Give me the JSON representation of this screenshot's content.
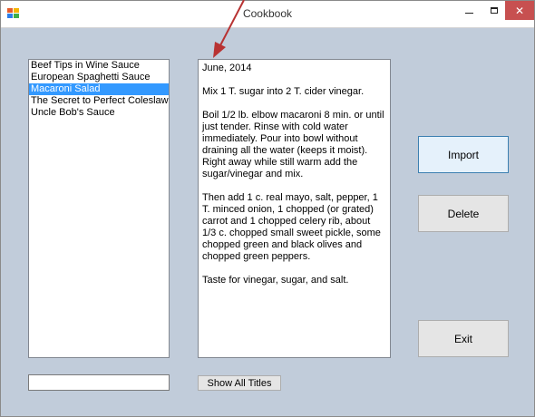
{
  "window": {
    "title": "Cookbook",
    "close_glyph": "✕"
  },
  "recipes": [
    {
      "title": "Beef Tips in Wine Sauce",
      "selected": false
    },
    {
      "title": "European Spaghetti Sauce",
      "selected": false
    },
    {
      "title": "Macaroni Salad",
      "selected": true
    },
    {
      "title": "The Secret to Perfect Coleslaw",
      "selected": false
    },
    {
      "title": "Uncle Bob's Sauce",
      "selected": false
    }
  ],
  "recipe_text": [
    "June, 2014",
    "Mix 1 T. sugar into 2 T. cider vinegar.",
    "Boil 1/2 lb. elbow macaroni 8 min. or until just tender. Rinse with cold water immediately. Pour into bowl without draining all the water (keeps it moist). Right away while still warm add the sugar/vinegar and mix.",
    "Then add 1 c. real mayo, salt, pepper, 1 T. minced onion, 1 chopped (or grated) carrot and 1 chopped celery rib, about 1/3 c. chopped small sweet pickle, some chopped green and black olives and chopped green peppers.",
    "Taste for vinegar, sugar, and salt."
  ],
  "buttons": {
    "import": "Import",
    "delete": "Delete",
    "exit": "Exit",
    "show_all": "Show All Titles"
  },
  "search": {
    "value": "",
    "placeholder": ""
  },
  "colors": {
    "form_bg": "#c1ccda",
    "selection": "#3399ff",
    "close_button": "#c75050",
    "annotation_arrow": "#b83232"
  }
}
